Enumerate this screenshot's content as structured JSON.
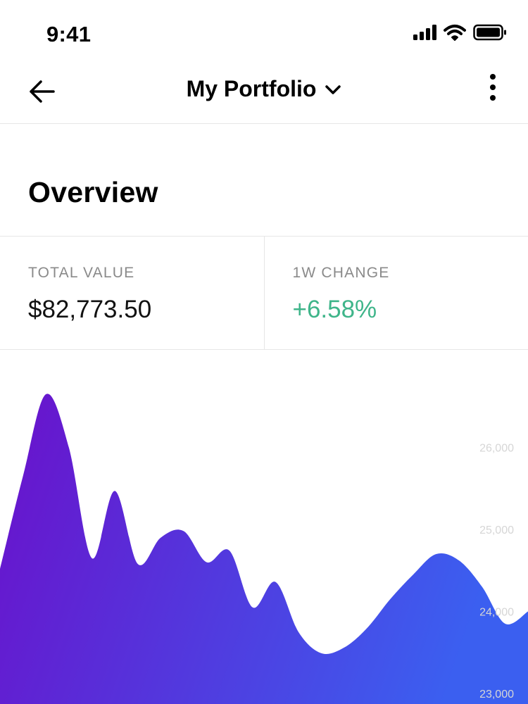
{
  "status_bar": {
    "time": "9:41",
    "icons": [
      "cellular-signal-icon",
      "wifi-icon",
      "battery-icon"
    ]
  },
  "nav": {
    "back_icon": "arrow-left-icon",
    "title": "My Portfolio",
    "title_icon": "chevron-down-icon",
    "more_icon": "more-vertical-icon"
  },
  "overview": {
    "title": "Overview"
  },
  "stats": {
    "total_value_label": "TOTAL VALUE",
    "total_value": "$82,773.50",
    "change_label": "1W CHANGE",
    "change_value": "+6.58%"
  },
  "colors": {
    "positive": "#3fb58a",
    "gradient_start": "#6a11cb",
    "gradient_end": "#3b5ff0"
  },
  "chart_data": {
    "type": "area",
    "title": "",
    "xlabel": "",
    "ylabel": "",
    "grid": false,
    "ylim": [
      23000,
      27000
    ],
    "y_ticks": [
      "26,000",
      "25,000",
      "24,000",
      "23,000"
    ],
    "y_tick_values": [
      26000,
      25000,
      24000,
      23000
    ],
    "series": [
      {
        "x": [
          0,
          1,
          2,
          3,
          4,
          5,
          6,
          7,
          8,
          9,
          10,
          11,
          12,
          13,
          14,
          15,
          16,
          17,
          18,
          19,
          20,
          21,
          22,
          23
        ],
        "y": [
          24520,
          25650,
          26650,
          26000,
          24650,
          25470,
          24580,
          24900,
          24980,
          24600,
          24740,
          24050,
          24360,
          23750,
          23490,
          23560,
          23800,
          24150,
          24450,
          24700,
          24620,
          24300,
          23850,
          24000
        ]
      }
    ]
  }
}
